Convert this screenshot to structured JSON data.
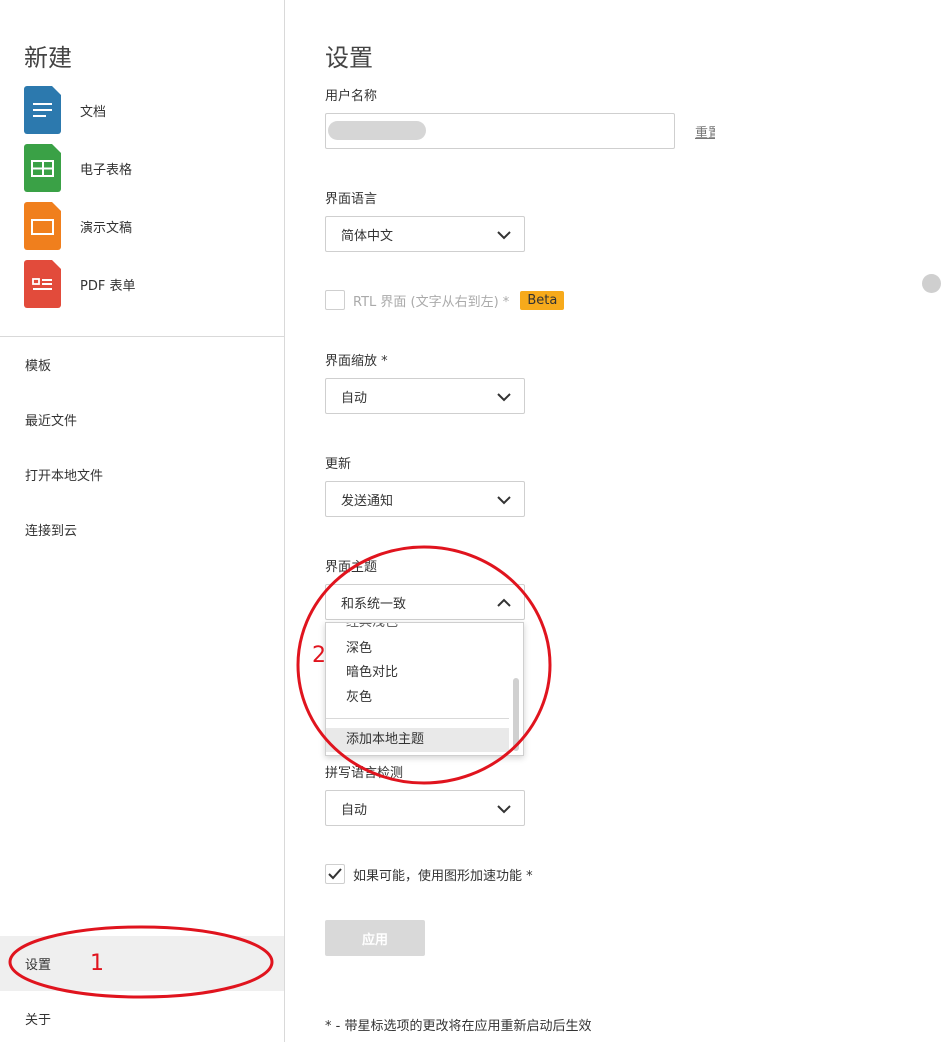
{
  "sidebar": {
    "new_title": "新建",
    "new_items": [
      {
        "label": "文档",
        "icon": "document-icon",
        "color": "#2c79ae"
      },
      {
        "label": "电子表格",
        "icon": "spreadsheet-icon",
        "color": "#3aa146"
      },
      {
        "label": "演示文稿",
        "icon": "presentation-icon",
        "color": "#f07f1d"
      },
      {
        "label": "PDF 表单",
        "icon": "pdf-form-icon",
        "color": "#e24b3b"
      }
    ],
    "nav": [
      {
        "label": "模板"
      },
      {
        "label": "最近文件"
      },
      {
        "label": "打开本地文件"
      },
      {
        "label": "连接到云"
      }
    ],
    "bottom_nav": [
      {
        "label": "设置",
        "active": true
      },
      {
        "label": "关于"
      }
    ]
  },
  "settings": {
    "title": "设置",
    "username": {
      "label": "用户名称",
      "value": "",
      "reset_label": "重置"
    },
    "language": {
      "label": "界面语言",
      "value": "简体中文"
    },
    "rtl": {
      "label": "RTL 界面 (文字从右到左) *",
      "checked": false,
      "badge": "Beta",
      "badge_color": "#f7aa1b"
    },
    "scaling": {
      "label": "界面缩放 *",
      "value": "自动"
    },
    "updates": {
      "label": "更新",
      "value": "发送通知"
    },
    "theme": {
      "label": "界面主题",
      "value": "和系统一致",
      "options": [
        "深色",
        "暗色对比",
        "灰色"
      ],
      "partial_option": "经典浅色",
      "add_option": "添加本地主题"
    },
    "spellcheck": {
      "label": "拼写语言检测",
      "value": "自动"
    },
    "gpu": {
      "label": "如果可能，使用图形加速功能 *",
      "checked": true
    },
    "apply_label": "应用",
    "footnote": "* - 带星标选项的更改将在应用重新启动后生效"
  },
  "annotations": {
    "marker1": "1",
    "marker2": "2",
    "color": "#e0141e"
  }
}
